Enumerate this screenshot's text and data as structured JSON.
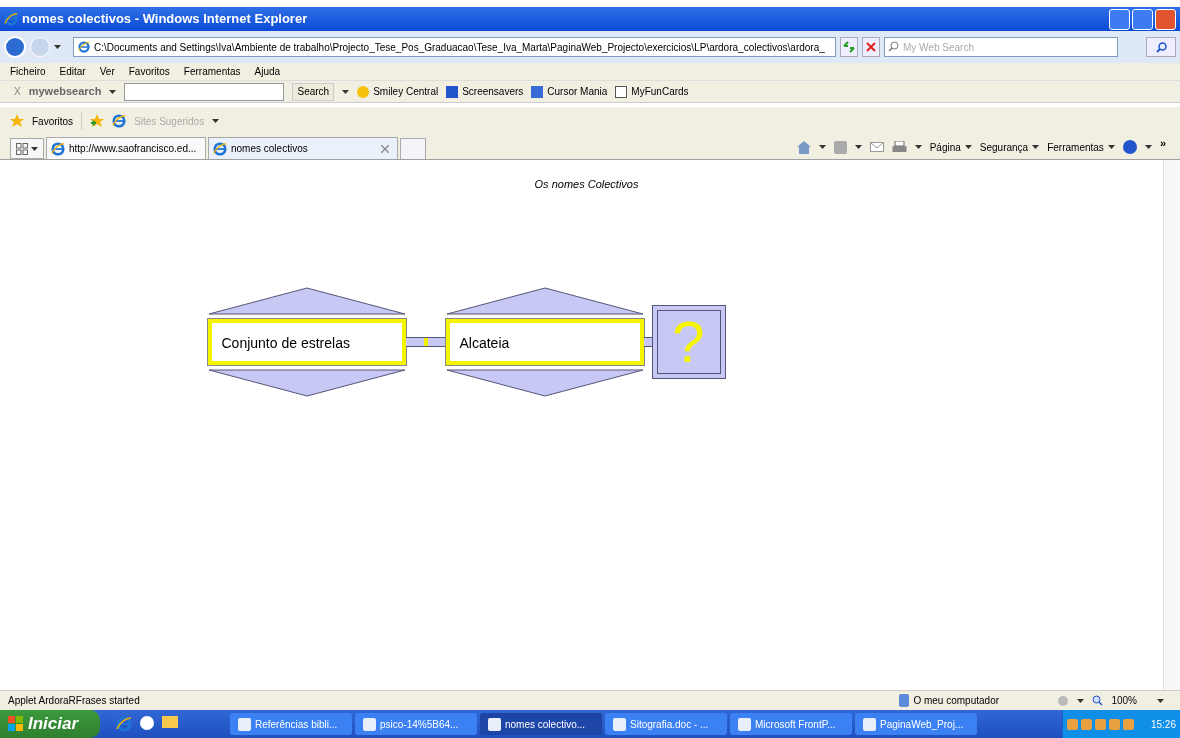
{
  "window": {
    "title": "nomes colectivos - Windows Internet Explorer"
  },
  "address_bar": {
    "value": "C:\\Documents and Settings\\Iva\\Ambiente de trabalho\\Projecto_Tese_Pos_Graduacao\\Tese_Iva_Marta\\PaginaWeb_Projecto\\exercicios\\LP\\ardora_colectivos\\ardora_"
  },
  "search_field": {
    "placeholder": "My Web Search"
  },
  "menu": [
    "Ficheiro",
    "Editar",
    "Ver",
    "Favoritos",
    "Ferramentas",
    "Ajuda"
  ],
  "websearch_toolbar": {
    "close": "X",
    "brand": "my**web**search",
    "search_button": "Search",
    "links": [
      "Smiley Central",
      "Screensavers",
      "Cursor Mania",
      "MyFunCards"
    ]
  },
  "favorites_bar": {
    "favorites": "Favoritos",
    "suggested": {
      "label": "Sites Sugeridos",
      "disabled": true
    }
  },
  "tabs": [
    {
      "label": "http://www.saofrancisco.ed...",
      "selected": false
    },
    {
      "label": "nomes colectivos",
      "selected": true
    }
  ],
  "command_bar": {
    "items": [
      "Página",
      "Segurança",
      "Ferramentas"
    ],
    "more": "»"
  },
  "page": {
    "heading": "Os nomes Colectivos",
    "pieces": [
      {
        "text": "Conjunto de estrelas"
      },
      {
        "text": "Alcateia"
      }
    ],
    "mystery": "?"
  },
  "status_bar": {
    "text": "Applet ArdoraRFrases started",
    "zone": "O meu computador",
    "zoom": "100%"
  },
  "taskbar": {
    "start": "Iniciar",
    "tasks": [
      {
        "label": "Referências bibli...",
        "selected": false
      },
      {
        "label": "psico-14%5B64...",
        "selected": false
      },
      {
        "label": "nomes colectivo...",
        "selected": true
      },
      {
        "label": "Sitografia.doc - ...",
        "selected": false
      },
      {
        "label": "Microsoft FrontP...",
        "selected": false
      },
      {
        "label": "PaginaWeb_Proj...",
        "selected": false
      }
    ],
    "clock": "15:26"
  }
}
